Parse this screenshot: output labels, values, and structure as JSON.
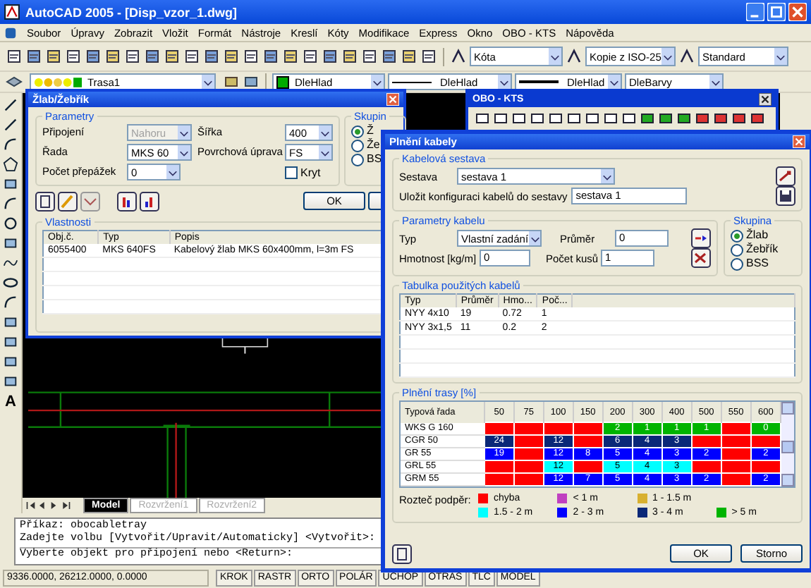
{
  "window": {
    "title": "AutoCAD 2005 - [Disp_vzor_1.dwg]"
  },
  "menu": [
    "Soubor",
    "Úpravy",
    "Zobrazit",
    "Vložit",
    "Formát",
    "Nástroje",
    "Kreslí",
    "Kóty",
    "Modifikace",
    "Express",
    "Okno",
    "OBO - KTS",
    "Nápověda"
  ],
  "toolbar_1": {
    "dropdowns": [
      "Kóta",
      "Kopie z ISO-25",
      "Standard"
    ]
  },
  "toolbar_2": {
    "layer": "Trasa1",
    "layer_color": "DleHlad",
    "linetype": "DleHlad",
    "lineweight": "DleHlad",
    "plot_style": "DleBarvy"
  },
  "draw_toolbar": {
    "text_tool": "A"
  },
  "layout_tabs": [
    {
      "label": "Model",
      "selected": true
    },
    {
      "label": "Rozvržení1",
      "selected": false
    },
    {
      "label": "Rozvržení2",
      "selected": false
    }
  ],
  "command_lines": [
    "Příkaz: obocabletray",
    "Zadejte volbu [Vytvořit/Upravit/Automaticky] <Vytvořit>:",
    "Vyberte objekt pro připojení nebo <Return>:"
  ],
  "status_bar": {
    "coordinates": "9336.0000, 26212.0000, 0.0000",
    "toggles": [
      "KROK",
      "RASTR",
      "ORTO",
      "POLÁR",
      "UCHOP",
      "OTRAS",
      "TLC",
      "MODEL"
    ]
  },
  "tray_dialog": {
    "title": "Žlab/Žebřík",
    "parameters": {
      "title": "Parametry",
      "connection": {
        "label": "Připojení",
        "value": "Nahoru",
        "disabled": true
      },
      "series": {
        "label": "Řada",
        "value": "MKS 60"
      },
      "partitions": {
        "label": "Počet přepážek",
        "value": "0"
      },
      "width": {
        "label": "Šířka",
        "value": "400"
      },
      "finish": {
        "label": "Povrchová úprava",
        "value": "FS"
      },
      "cover": {
        "label": "Kryt",
        "checked": false
      }
    },
    "group": {
      "title": "Skupin",
      "options": [
        {
          "label": "Ž",
          "selected": true
        },
        {
          "label": "Že",
          "selected": false
        },
        {
          "label": "BS",
          "selected": false
        }
      ]
    },
    "ok": "OK",
    "properties": {
      "title": "Vlastnosti",
      "columns": [
        "Obj.č.",
        "Typ",
        "Popis"
      ],
      "rows": [
        [
          "6055400",
          "MKS 640FS",
          "Kabelový žlab MKS 60x400mm, l=3m   FS"
        ]
      ]
    }
  },
  "obo_toolbar": {
    "title": "OBO - KTS"
  },
  "cable_dialog": {
    "title": "Plnění kabely",
    "cable_set": {
      "title": "Kabelová sestava",
      "set_label": "Sestava",
      "set_value": "sestava 1",
      "save_label": "Uložit konfiguraci kabelů do sestavy",
      "save_value": "sestava 1"
    },
    "cable": {
      "title": "Parametry kabelu",
      "type_label": "Typ",
      "type_value": "Vlastní zadání",
      "diameter_label": "Průměr",
      "diameter_value": "0",
      "weight_label": "Hmotnost [kg/m]",
      "weight_value": "0",
      "count_label": "Počet kusů",
      "count_value": "1"
    },
    "group": {
      "title": "Skupina",
      "options": [
        {
          "label": "Žlab",
          "selected": true
        },
        {
          "label": "Žebřík",
          "selected": false
        },
        {
          "label": "BSS",
          "selected": false
        }
      ]
    },
    "cables_table": {
      "title": "Tabulka použitých kabelů",
      "columns": [
        "Typ",
        "Průměr",
        "Hmo...",
        "Poč..."
      ],
      "rows": [
        [
          "NYY 4x10",
          "19",
          "0.72",
          "1"
        ],
        [
          "NYY 3x1,5",
          "11",
          "0.2",
          "2"
        ]
      ]
    },
    "fill": {
      "title": "Plnění trasy [%]",
      "header": "Typová řada",
      "columns": [
        "50",
        "75",
        "100",
        "150",
        "200",
        "300",
        "400",
        "500",
        "550",
        "600"
      ],
      "rows": [
        {
          "name": "WKS G 160",
          "cells": [
            {
              "color": "#ff0000"
            },
            {
              "color": "#ff0000"
            },
            {
              "color": "#ff0000"
            },
            {
              "color": "#ff0000"
            },
            {
              "value": "2",
              "color": "#00b400"
            },
            {
              "value": "1",
              "color": "#00b400"
            },
            {
              "value": "1",
              "color": "#00b400"
            },
            {
              "value": "1",
              "color": "#00b400"
            },
            {
              "color": "#ff0000"
            },
            {
              "value": "0",
              "color": "#00b400"
            }
          ]
        },
        {
          "name": "CGR 50",
          "cells": [
            {
              "value": "24",
              "color": "#0a2878"
            },
            {
              "color": "#ff0000"
            },
            {
              "value": "12",
              "color": "#0a2878"
            },
            {
              "color": "#ff0000"
            },
            {
              "value": "6",
              "color": "#0a2878"
            },
            {
              "value": "4",
              "color": "#0a2878"
            },
            {
              "value": "3",
              "color": "#0a2878"
            },
            {
              "color": "#ff0000"
            },
            {
              "color": "#ff0000"
            },
            {
              "color": "#ff0000"
            }
          ]
        },
        {
          "name": "GR 55",
          "cells": [
            {
              "value": "19",
              "color": "#0000ff"
            },
            {
              "color": "#ff0000"
            },
            {
              "value": "12",
              "color": "#0000ff"
            },
            {
              "value": "8",
              "color": "#0000ff"
            },
            {
              "value": "5",
              "color": "#0000ff"
            },
            {
              "value": "4",
              "color": "#0000ff"
            },
            {
              "value": "3",
              "color": "#0000ff"
            },
            {
              "value": "2",
              "color": "#0000ff"
            },
            {
              "color": "#ff0000"
            },
            {
              "value": "2",
              "color": "#0000ff"
            }
          ]
        },
        {
          "name": "GRL 55",
          "cells": [
            {
              "color": "#ff0000"
            },
            {
              "color": "#ff0000"
            },
            {
              "value": "12",
              "color": "#00ffff"
            },
            {
              "color": "#ff0000"
            },
            {
              "value": "5",
              "color": "#00ffff"
            },
            {
              "value": "4",
              "color": "#00ffff"
            },
            {
              "value": "3",
              "color": "#00ffff"
            },
            {
              "color": "#ff0000"
            },
            {
              "color": "#ff0000"
            },
            {
              "color": "#ff0000"
            }
          ]
        },
        {
          "name": "GRM 55",
          "cells": [
            {
              "color": "#ff0000"
            },
            {
              "color": "#ff0000"
            },
            {
              "value": "12",
              "color": "#0000ff"
            },
            {
              "value": "7",
              "color": "#0000ff"
            },
            {
              "value": "5",
              "color": "#0000ff"
            },
            {
              "value": "4",
              "color": "#0000ff"
            },
            {
              "value": "3",
              "color": "#0000ff"
            },
            {
              "value": "2",
              "color": "#0000ff"
            },
            {
              "color": "#ff0000"
            },
            {
              "value": "2",
              "color": "#0000ff"
            }
          ]
        }
      ]
    },
    "legend": {
      "title": "Rozteč podpěr:",
      "items": [
        {
          "label": "chyba",
          "color": "#ff0000"
        },
        {
          "label": "< 1 m",
          "color": "#c040c0"
        },
        {
          "label": "1 - 1.5 m",
          "color": "#d8b030"
        },
        {
          "label": "1.5 - 2 m",
          "color": "#00ffff"
        },
        {
          "label": "2 - 3 m",
          "color": "#0000ff"
        },
        {
          "label": "3 - 4 m",
          "color": "#0a2878"
        },
        {
          "label": "> 5 m",
          "color": "#00b400"
        }
      ]
    },
    "buttons": [
      "OK",
      "Storno"
    ]
  }
}
